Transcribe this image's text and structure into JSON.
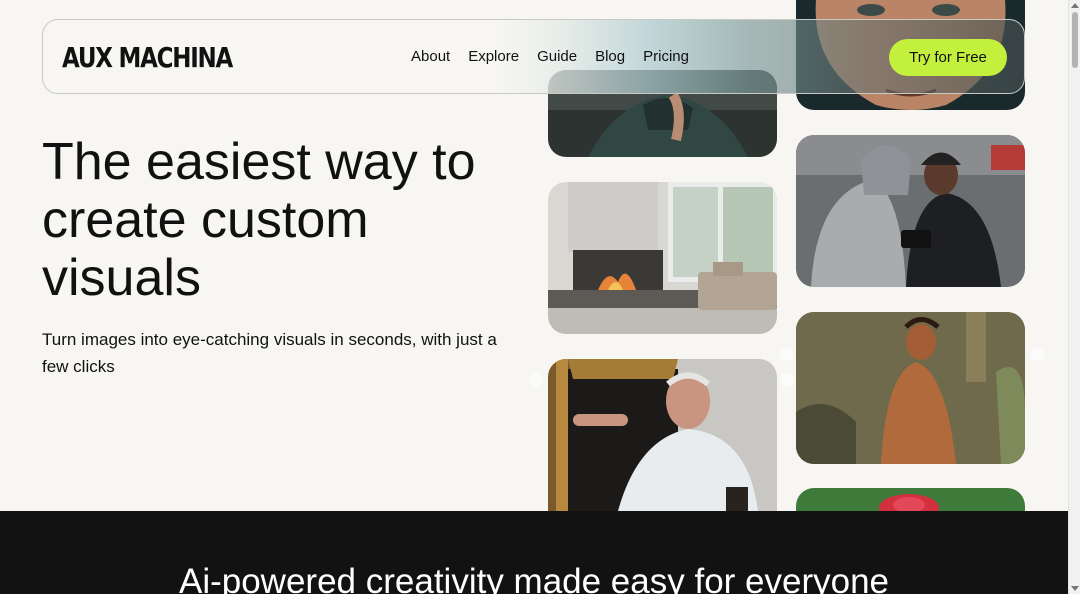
{
  "brand": {
    "logo": "AUX MACHINA"
  },
  "nav": {
    "items": [
      "About",
      "Explore",
      "Guide",
      "Blog",
      "Pricing"
    ]
  },
  "cta": {
    "label": "Try for Free",
    "color": "#c3ef3d"
  },
  "hero": {
    "title": "The easiest way to create custom visuals",
    "subtitle": "Turn images into eye-catching visuals in seconds, with just a few clicks"
  },
  "gallery": {
    "images": [
      "person-in-hoodie-photo",
      "modern-fireplace-living-room-photo",
      "old-man-leaning-out-of-frame-photo",
      "close-up-face-photo",
      "two-men-with-camera-street-photo",
      "shirtless-man-graffiti-wall-photo",
      "red-rose-photo"
    ]
  },
  "section2": {
    "title": "Ai-powered creativity made easy for everyone",
    "background": "#121212"
  }
}
